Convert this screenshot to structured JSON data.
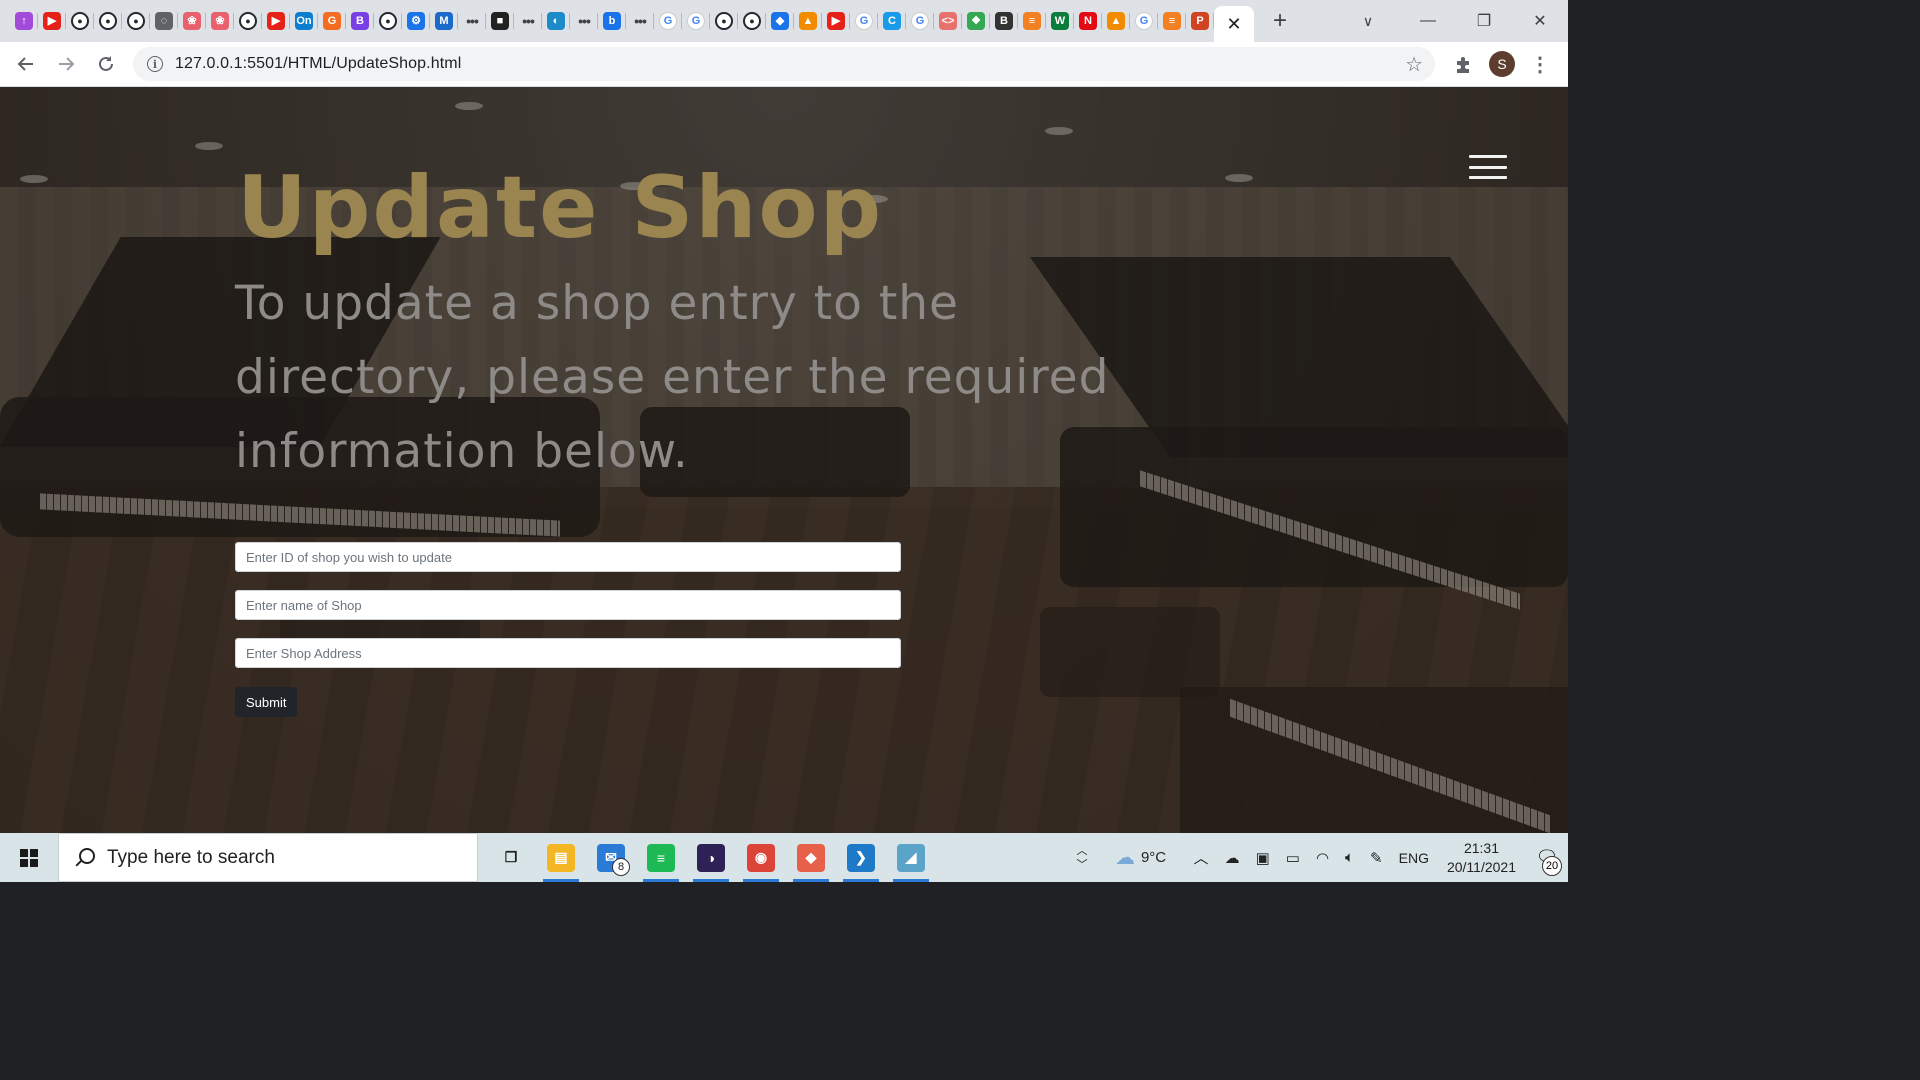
{
  "browser": {
    "url": "127.0.0.1:5501/HTML/UpdateShop.html",
    "pinned_tabs": [
      {
        "icon": "ublock-icon",
        "glyph": "↑",
        "color": "#a24bd8"
      },
      {
        "icon": "youtube-icon",
        "glyph": "▶",
        "color": "#e62117"
      },
      {
        "icon": "github-icon",
        "glyph": "●",
        "color": "#24292e"
      },
      {
        "icon": "github-icon",
        "glyph": "●",
        "color": "#24292e"
      },
      {
        "icon": "github-icon",
        "glyph": "●",
        "color": "#24292e"
      },
      {
        "icon": "globe-icon",
        "glyph": "◌",
        "color": "#5f6368"
      },
      {
        "icon": "openai-icon",
        "glyph": "❀",
        "color": "#e8616d"
      },
      {
        "icon": "openai-icon",
        "glyph": "❀",
        "color": "#e8616d"
      },
      {
        "icon": "github-icon",
        "glyph": "●",
        "color": "#24292e"
      },
      {
        "icon": "youtube-icon",
        "glyph": "▶",
        "color": "#e62117"
      },
      {
        "icon": "onshape-icon",
        "glyph": "On",
        "color": "#0b7ed0"
      },
      {
        "icon": "g-icon",
        "glyph": "G",
        "color": "#f36c21"
      },
      {
        "icon": "bootstrap-icon",
        "glyph": "B",
        "color": "#7a3fe4"
      },
      {
        "icon": "github-icon",
        "glyph": "●",
        "color": "#24292e"
      },
      {
        "icon": "gear-icon",
        "glyph": "⚙",
        "color": "#1a73e8"
      },
      {
        "icon": "mdn-icon",
        "glyph": "M",
        "color": "#1b6ac9"
      },
      {
        "icon": "ellipsis-icon",
        "glyph": "•••",
        "color": "transparent"
      },
      {
        "icon": "app-icon",
        "glyph": "■",
        "color": "#222222"
      },
      {
        "icon": "ellipsis-icon",
        "glyph": "•••",
        "color": "transparent"
      },
      {
        "icon": "app-icon",
        "glyph": "◐",
        "color": "#1d8ac9"
      },
      {
        "icon": "ellipsis-icon",
        "glyph": "•••",
        "color": "transparent"
      },
      {
        "icon": "bing-icon",
        "glyph": "b",
        "color": "#1a73e8"
      },
      {
        "icon": "ellipsis-icon",
        "glyph": "•••",
        "color": "transparent"
      },
      {
        "icon": "google-icon",
        "glyph": "G",
        "color": "#ffffff"
      },
      {
        "icon": "google-icon",
        "glyph": "G",
        "color": "#ffffff"
      },
      {
        "icon": "github-icon",
        "glyph": "●",
        "color": "#24292e"
      },
      {
        "icon": "github-icon",
        "glyph": "●",
        "color": "#24292e"
      },
      {
        "icon": "diamond-icon",
        "glyph": "◆",
        "color": "#1a73e8"
      },
      {
        "icon": "orange-app-icon",
        "glyph": "▲",
        "color": "#f28b00"
      },
      {
        "icon": "youtube-icon",
        "glyph": "▶",
        "color": "#e62117"
      },
      {
        "icon": "google-icon",
        "glyph": "G",
        "color": "#ffffff"
      },
      {
        "icon": "c-icon",
        "glyph": "C",
        "color": "#1a9be8"
      },
      {
        "icon": "google-icon",
        "glyph": "G",
        "color": "#ffffff"
      },
      {
        "icon": "code-icon",
        "glyph": "<>",
        "color": "#e8716d"
      },
      {
        "icon": "colorful-icon",
        "glyph": "❖",
        "color": "#34a853"
      },
      {
        "icon": "bootstrap-icon",
        "glyph": "B",
        "color": "#333333"
      },
      {
        "icon": "stackoverflow-icon",
        "glyph": "≡",
        "color": "#f48024"
      },
      {
        "icon": "w-icon",
        "glyph": "W",
        "color": "#0a7d3c"
      },
      {
        "icon": "netflix-icon",
        "glyph": "N",
        "color": "#e50914"
      },
      {
        "icon": "orange-app-icon",
        "glyph": "▲",
        "color": "#f28b00"
      },
      {
        "icon": "google-icon",
        "glyph": "G",
        "color": "#ffffff"
      },
      {
        "icon": "stackoverflow-icon",
        "glyph": "≡",
        "color": "#f48024"
      },
      {
        "icon": "powerpoint-icon",
        "glyph": "P",
        "color": "#d04423"
      }
    ],
    "active_tab_close": "✕",
    "new_tab": "+",
    "window_controls": [
      "—",
      "❐",
      "✕"
    ],
    "tab_search": "∨",
    "profile_initial": "S"
  },
  "page": {
    "title": "Update Shop",
    "subtitle": "To update a shop entry to the directory, please enter the required information below.",
    "form": {
      "shop_id_placeholder": "Enter ID of shop you wish to update",
      "shop_name_placeholder": "Enter name of Shop",
      "shop_address_placeholder": "Enter Shop Address",
      "submit_label": "Submit"
    },
    "colors": {
      "title": "#9a8550",
      "subtitle": "#8d8a88",
      "submit_bg": "#212529"
    }
  },
  "taskbar": {
    "search_placeholder": "Type here to search",
    "apps": [
      {
        "icon": "task-view-icon",
        "glyph": "❐",
        "color": "#d9e4e8",
        "open": false
      },
      {
        "icon": "file-explorer-icon",
        "glyph": "▤",
        "color": "#f3b723",
        "open": true
      },
      {
        "icon": "mail-icon",
        "glyph": "✉",
        "color": "#2b7bd6",
        "open": false,
        "badge": "8"
      },
      {
        "icon": "spotify-icon",
        "glyph": "≡",
        "color": "#1db954",
        "open": true
      },
      {
        "icon": "eclipse-icon",
        "glyph": "◑",
        "color": "#2c2255",
        "open": true
      },
      {
        "icon": "chrome-icon",
        "glyph": "◉",
        "color": "#db4437",
        "open": true
      },
      {
        "icon": "git-icon",
        "glyph": "◆",
        "color": "#e6604a",
        "open": true
      },
      {
        "icon": "vscode-icon",
        "glyph": "❯",
        "color": "#1e79c7",
        "open": true
      },
      {
        "icon": "app-icon",
        "glyph": "◢",
        "color": "#5aa3c9",
        "open": true
      }
    ],
    "weather": "9°C",
    "language": "ENG",
    "time": "21:31",
    "date": "20/11/2021",
    "notification_count": "20"
  }
}
